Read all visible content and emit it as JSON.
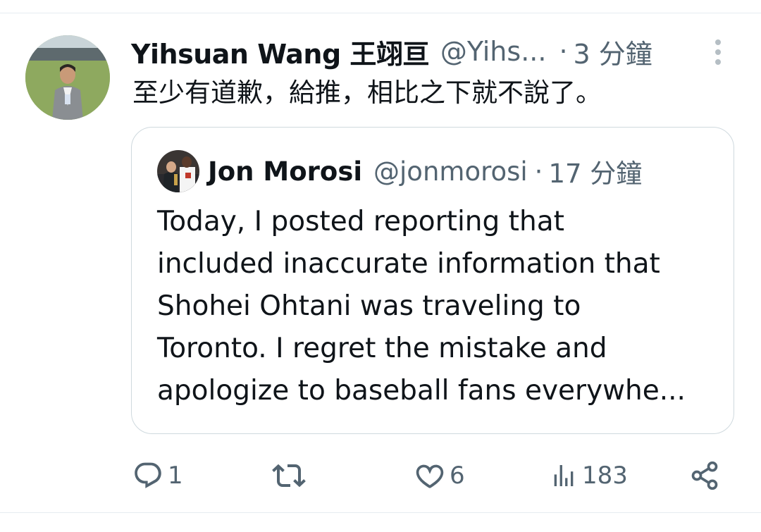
{
  "tweet": {
    "display_name": "Yihsuan Wang 王翊亘",
    "handle": "@Yihs...",
    "separator": "·",
    "time": "3 分鐘",
    "text": "至少有道歉，給推，相比之下就不說了。"
  },
  "quote": {
    "display_name": "Jon Morosi",
    "handle": "@jonmorosi",
    "separator": "·",
    "time": "17 分鐘",
    "text_lines": [
      "Today, I posted reporting that",
      "included inaccurate information that",
      "Shohei Ohtani was traveling to",
      "Toronto. I regret the mistake and",
      "apologize to baseball fans everywhe..."
    ]
  },
  "actions": {
    "reply_count": "1",
    "retweet_count": "",
    "like_count": "6",
    "views_count": "183"
  },
  "icons": {
    "more": "more-vertical-icon",
    "reply": "reply-icon",
    "retweet": "retweet-icon",
    "like": "heart-icon",
    "views": "views-icon",
    "share": "share-icon"
  },
  "colors": {
    "text": "#0f1419",
    "secondary": "#536471",
    "border": "#cfd9de"
  }
}
